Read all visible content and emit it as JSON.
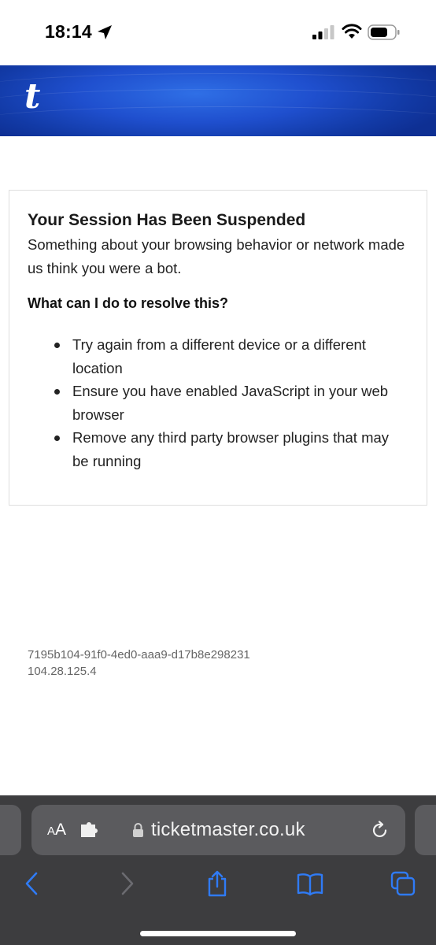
{
  "status_bar": {
    "time": "18:14",
    "icons": [
      "location-arrow-icon",
      "cellular-signal-icon",
      "wifi-icon",
      "battery-icon"
    ]
  },
  "header": {
    "logo": "t",
    "brand_color": "#1f4fce"
  },
  "card": {
    "title": "Your Session Has Been Suspended",
    "description": "Something about your browsing behavior or network made us think you were a bot.",
    "subtitle": "What can I do to resolve this?",
    "tips": [
      "Try again from a different device or a different location",
      "Ensure you have enabled JavaScript in your web browser",
      "Remove any third party browser plugins that may be running"
    ]
  },
  "reference": {
    "session_id": "7195b104-91f0-4ed0-aaa9-d17b8e298231",
    "ip": "104.28.125.4"
  },
  "safari": {
    "aa_small": "A",
    "aa_large": "A",
    "url": "ticketmaster.co.uk",
    "toolbar_icons": [
      "back-chevron-icon",
      "forward-chevron-icon",
      "share-icon",
      "bookmarks-icon",
      "tabs-icon"
    ],
    "accent_color": "#2f7bf6"
  }
}
